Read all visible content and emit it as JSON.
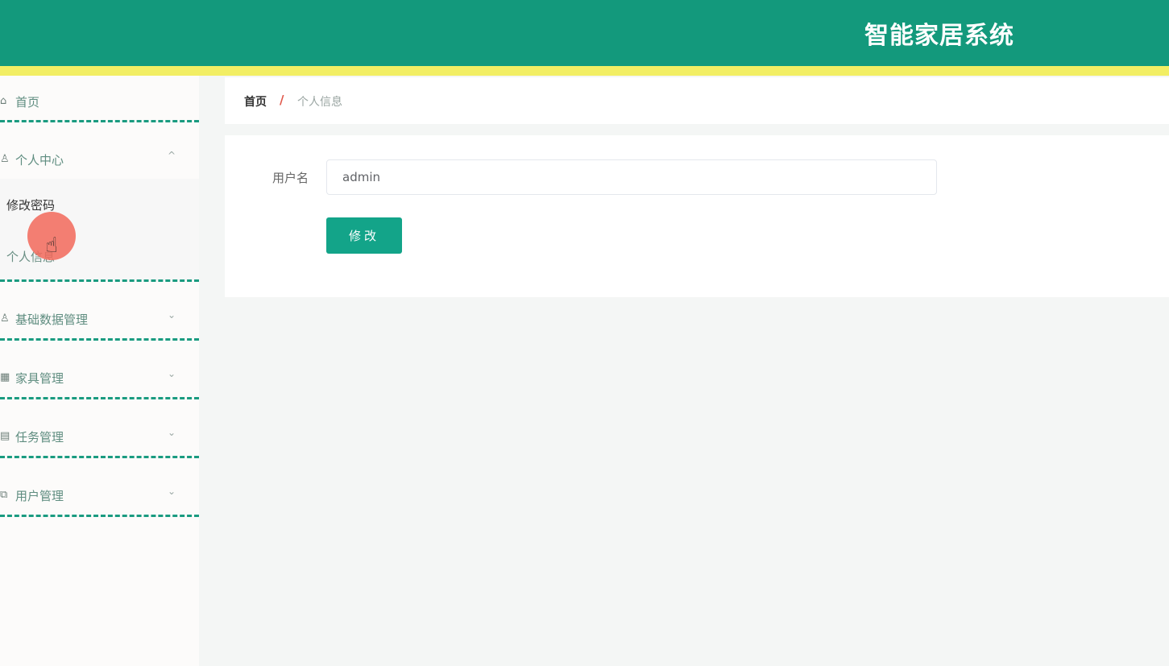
{
  "header": {
    "title": "智能家居系统",
    "bg_color": "#13997c",
    "stripe_color": "#f2ee64"
  },
  "sidebar": {
    "items": [
      {
        "label": "首页",
        "icon": "home-icon",
        "glyph": "⌂"
      },
      {
        "label": "个人中心",
        "icon": "user-icon",
        "glyph": "♙",
        "expanded": true,
        "chevron": "^"
      },
      {
        "label": "基础数据管理",
        "icon": "user-icon",
        "glyph": "♙",
        "chevron": "⌄"
      },
      {
        "label": "家具管理",
        "icon": "grid-icon",
        "glyph": "▦",
        "chevron": "⌄"
      },
      {
        "label": "任务管理",
        "icon": "list-icon",
        "glyph": "▤",
        "chevron": "⌄"
      },
      {
        "label": "用户管理",
        "icon": "copy-icon",
        "glyph": "⧉",
        "chevron": "⌄"
      }
    ],
    "submenu": [
      {
        "label": "修改密码",
        "active": true
      },
      {
        "label": "个人信息",
        "active": false
      }
    ],
    "accent_color": "#1a9b80"
  },
  "breadcrumb": {
    "home": "首页",
    "separator": "/",
    "current": "个人信息"
  },
  "form": {
    "username_label": "用户名",
    "username_value": "admin",
    "submit_label": "修改",
    "button_color": "#13a489"
  },
  "cursor": {
    "glyph": "☝"
  }
}
